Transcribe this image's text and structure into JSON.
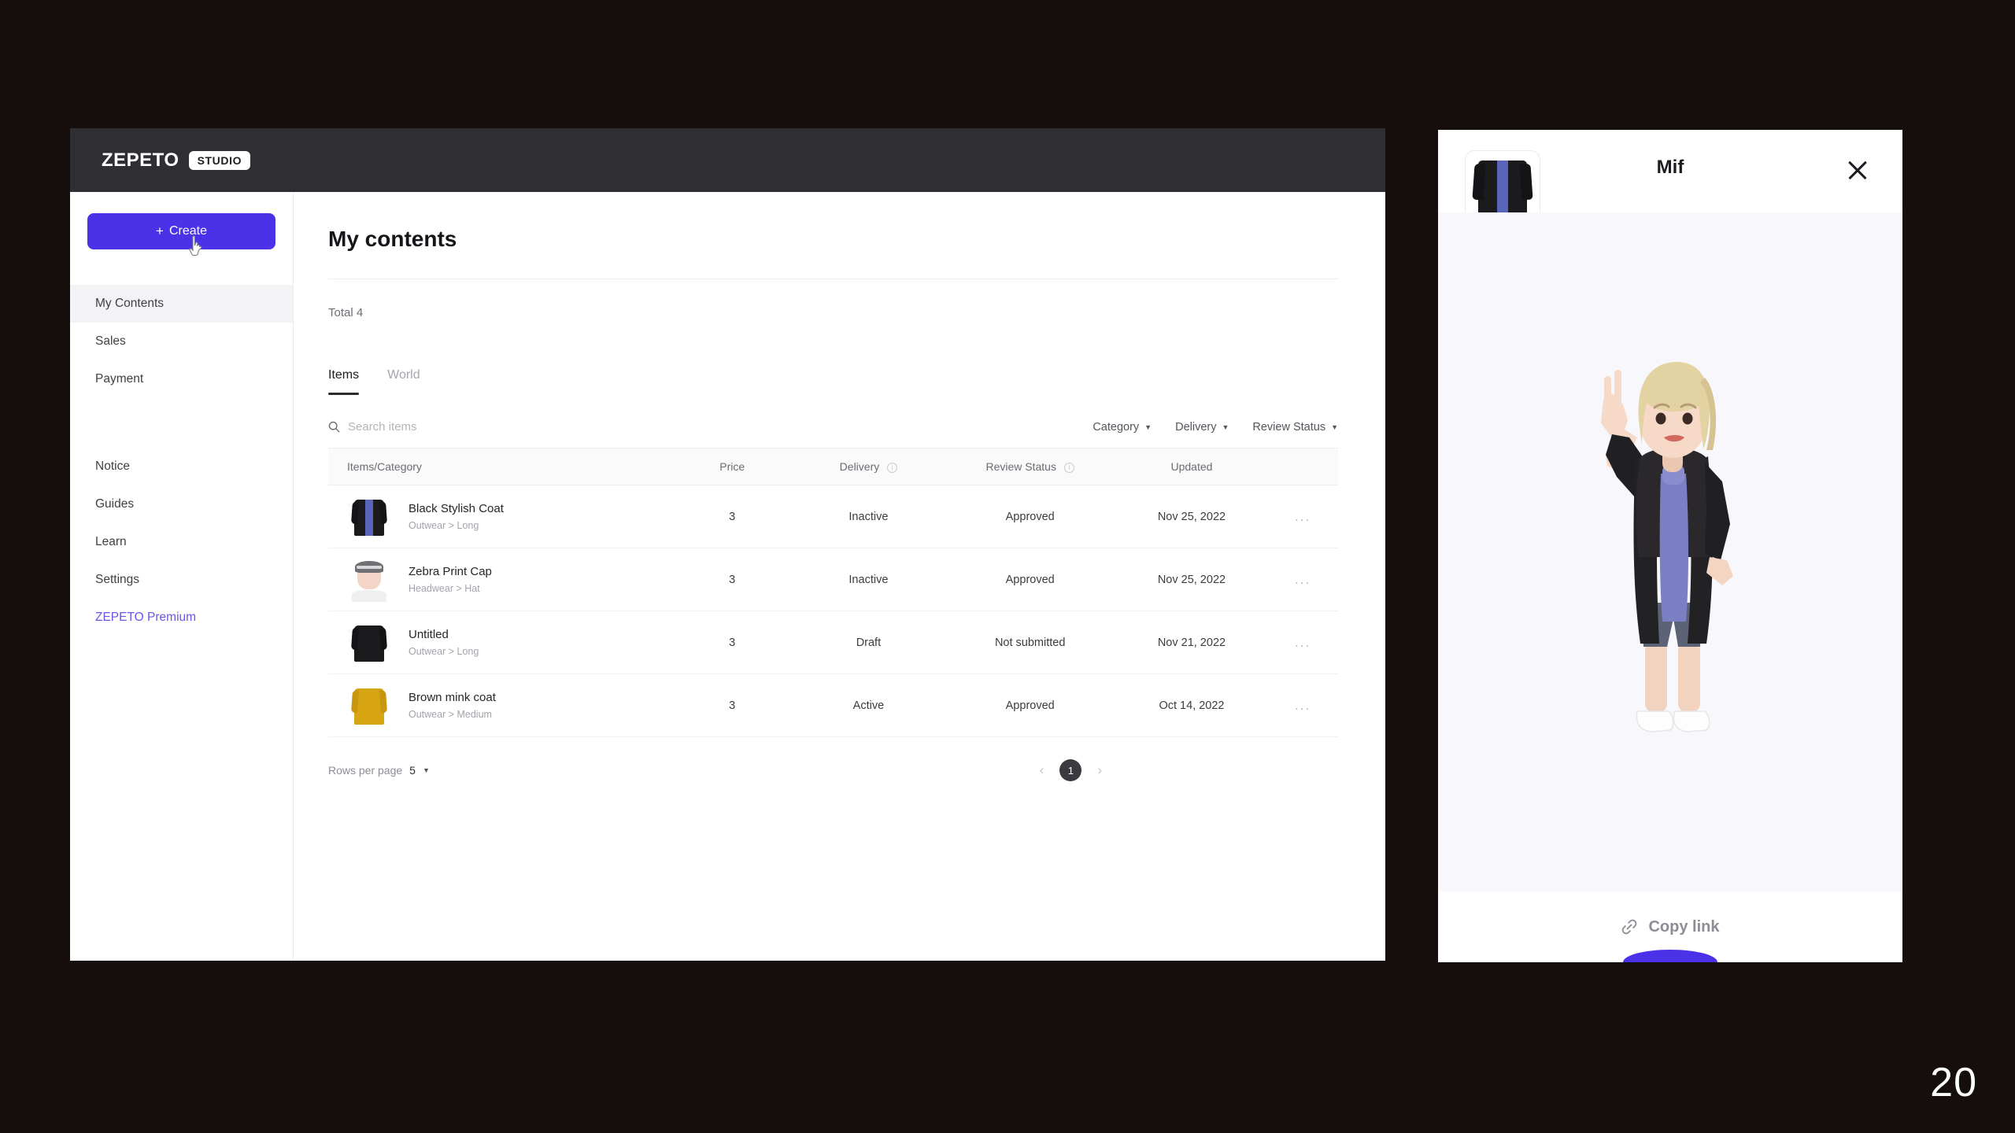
{
  "slide": {
    "number": "20"
  },
  "app": {
    "logo": {
      "name": "ZEPETO",
      "badge": "STUDIO"
    },
    "sidebar": {
      "create_button": {
        "label": "Create",
        "plus": "+"
      },
      "primary_items": [
        {
          "label": "My Contents",
          "active": true
        },
        {
          "label": "Sales",
          "active": false
        },
        {
          "label": "Payment",
          "active": false
        }
      ],
      "secondary_items": [
        {
          "label": "Notice",
          "accent": false
        },
        {
          "label": "Guides",
          "accent": false
        },
        {
          "label": "Learn",
          "accent": false
        },
        {
          "label": "Settings",
          "accent": false
        },
        {
          "label": "ZEPETO Premium",
          "accent": true
        }
      ]
    },
    "main": {
      "title": "My contents",
      "total": "Total 4",
      "tabs": [
        {
          "label": "Items",
          "active": true
        },
        {
          "label": "World",
          "active": false
        }
      ],
      "search": {
        "placeholder": "Search items",
        "value": "",
        "icon": "search-icon"
      },
      "filters": [
        {
          "label": "Category"
        },
        {
          "label": "Delivery"
        },
        {
          "label": "Review Status"
        }
      ],
      "table": {
        "headers": [
          {
            "label": "Items/Category",
            "info": false
          },
          {
            "label": "Price",
            "info": false
          },
          {
            "label": "Delivery",
            "info": true
          },
          {
            "label": "Review Status",
            "info": true
          },
          {
            "label": "Updated",
            "info": false
          }
        ],
        "rows": [
          {
            "name": "Black Stylish Coat",
            "category": "Outwear > Long",
            "price": "3",
            "delivery": "Inactive",
            "review_status": "Approved",
            "updated": "Nov 25, 2022",
            "thumb": "coat-black-blue-stripe",
            "menu": "..."
          },
          {
            "name": "Zebra Print Cap",
            "category": "Headwear > Hat",
            "price": "3",
            "delivery": "Inactive",
            "review_status": "Approved",
            "updated": "Nov 25, 2022",
            "thumb": "zebra-print-cap",
            "menu": "..."
          },
          {
            "name": "Untitled",
            "category": "Outwear > Long",
            "price": "3",
            "delivery": "Draft",
            "review_status": "Not submitted",
            "updated": "Nov 21, 2022",
            "thumb": "coat-black-plain",
            "menu": "..."
          },
          {
            "name": "Brown mink coat",
            "category": "Outwear > Medium",
            "price": "3",
            "delivery": "Active",
            "review_status": "Approved",
            "updated": "Oct 14, 2022",
            "thumb": "coat-gold-mink",
            "menu": "..."
          }
        ]
      },
      "pagination": {
        "rows_per_page_label": "Rows per page",
        "rows_per_page_value": "5",
        "prev": "‹",
        "next": "›",
        "current_page": "1"
      }
    }
  },
  "preview": {
    "title": "Mif",
    "close_icon": "close-icon",
    "thumb": "coat-black-blue-stripe",
    "avatar_alt": "zepeto-avatar-wearing-black-coat",
    "footer": {
      "label": "Copy link",
      "icon": "link-icon"
    }
  },
  "colors": {
    "brand_purple": "#4b31e8",
    "premium_link": "#6a55e8",
    "topbar": "#2e2e33",
    "page_bg": "#150e0c",
    "panel_stage": "#f8f7fb"
  }
}
